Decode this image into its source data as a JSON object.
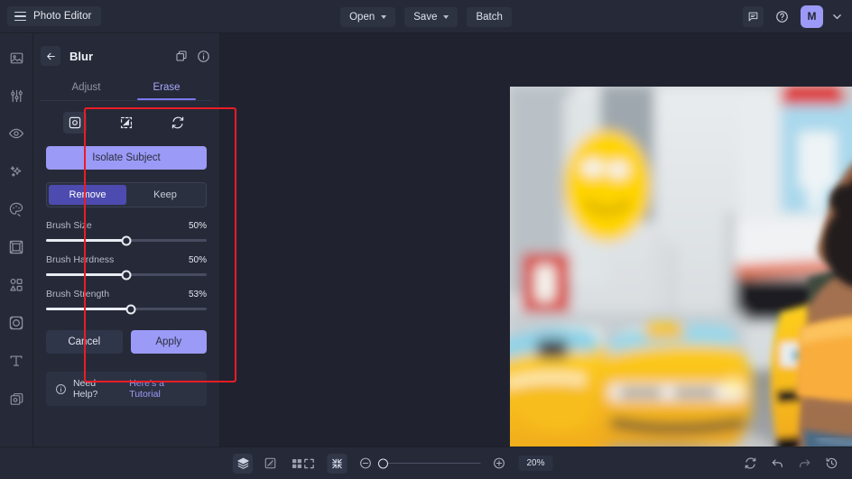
{
  "topbar": {
    "brand": "Photo Editor",
    "menu_icon": "hamburger-icon",
    "open_label": "Open",
    "save_label": "Save",
    "batch_label": "Batch",
    "feedback_icon": "chat-icon",
    "help_icon": "question-circle-icon",
    "avatar_initial": "M"
  },
  "rail": {
    "items": [
      {
        "name": "sidebar-item-image",
        "icon": "image-icon"
      },
      {
        "name": "sidebar-item-adjust",
        "icon": "sliders-icon"
      },
      {
        "name": "sidebar-item-retouch",
        "icon": "eye-icon"
      },
      {
        "name": "sidebar-item-effects",
        "icon": "sparkle-icon"
      },
      {
        "name": "sidebar-item-color",
        "icon": "palette-icon"
      },
      {
        "name": "sidebar-item-frame",
        "icon": "frame-icon"
      },
      {
        "name": "sidebar-item-shapes",
        "icon": "shapes-icon"
      },
      {
        "name": "sidebar-item-overlay",
        "icon": "overlay-icon"
      },
      {
        "name": "sidebar-item-text",
        "icon": "text-icon"
      },
      {
        "name": "sidebar-item-layers",
        "icon": "layers-copy-icon"
      }
    ]
  },
  "panel": {
    "back_icon": "arrow-left-icon",
    "title": "Blur",
    "duplicate_icon": "copy-icon",
    "info_icon": "info-circle-icon",
    "tabs": [
      {
        "label": "Adjust",
        "active": false
      },
      {
        "label": "Erase",
        "active": true
      }
    ],
    "tools": [
      {
        "name": "erase-brush-tool",
        "icon": "brush-square-icon",
        "selected": true
      },
      {
        "name": "erase-shape-tool",
        "icon": "dashed-square-icon",
        "selected": false
      },
      {
        "name": "erase-reset-tool",
        "icon": "refresh-icon",
        "selected": false
      }
    ],
    "isolate_label": "Isolate Subject",
    "segment": [
      {
        "label": "Remove",
        "active": true
      },
      {
        "label": "Keep",
        "active": false
      }
    ],
    "sliders": [
      {
        "label": "Brush Size",
        "value": "50%",
        "percent": 50
      },
      {
        "label": "Brush Hardness",
        "value": "50%",
        "percent": 50
      },
      {
        "label": "Brush Strength",
        "value": "53%",
        "percent": 53
      }
    ],
    "cancel_label": "Cancel",
    "apply_label": "Apply",
    "help_icon": "info-circle-icon",
    "help_text": "Need Help?",
    "help_link": "Here's a Tutorial"
  },
  "bottombar": {
    "left_tools": [
      {
        "name": "layers-button",
        "icon": "stack-icon",
        "selected": true
      },
      {
        "name": "compare-button",
        "icon": "compare-icon",
        "selected": false
      },
      {
        "name": "grid-button",
        "icon": "grid-icon",
        "selected": false
      }
    ],
    "fit_icon": "fit-screen-icon",
    "actual_icon": "shrink-icon",
    "zoom_out_icon": "minus-circle-icon",
    "zoom_in_icon": "plus-circle-icon",
    "zoom_value": "20%",
    "zoom_percent": 0,
    "right_tools": [
      {
        "name": "reset-button",
        "icon": "refresh-icon"
      },
      {
        "name": "undo-button",
        "icon": "undo-icon"
      },
      {
        "name": "redo-button",
        "icon": "redo-icon"
      },
      {
        "name": "history-button",
        "icon": "history-icon"
      }
    ]
  },
  "colors": {
    "accent": "#9b9af6",
    "panel_bg": "#262a38",
    "app_bg": "#20232f",
    "highlight_border": "#ec1c24"
  }
}
